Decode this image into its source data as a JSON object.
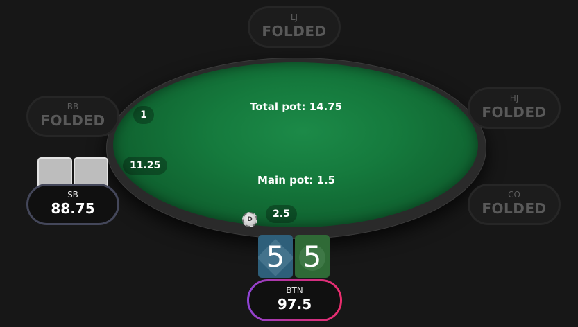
{
  "table": {
    "total_pot": "Total pot: 14.75",
    "main_pot": "Main pot: 1.5",
    "dealer_label": "D"
  },
  "bets": {
    "bb": "1",
    "sb": "11.25",
    "btn": "2.5"
  },
  "seats": {
    "lj": {
      "position": "LJ",
      "status": "FOLDED"
    },
    "hj": {
      "position": "HJ",
      "status": "FOLDED"
    },
    "bb": {
      "position": "BB",
      "status": "FOLDED"
    },
    "co": {
      "position": "CO",
      "status": "FOLDED"
    },
    "sb": {
      "position": "SB",
      "stack": "88.75"
    },
    "btn": {
      "position": "BTN",
      "stack": "97.5"
    }
  },
  "hero_cards": [
    {
      "rank": "5",
      "suit": "diamonds",
      "color": "#2e5f7a"
    },
    {
      "rank": "5",
      "suit": "clubs",
      "color": "#2f6a36"
    }
  ],
  "colors": {
    "felt": "#157a3d",
    "hero_ring_start": "#8e44d6",
    "hero_ring_end": "#ec2d6d",
    "active_ring": "#44475a"
  }
}
